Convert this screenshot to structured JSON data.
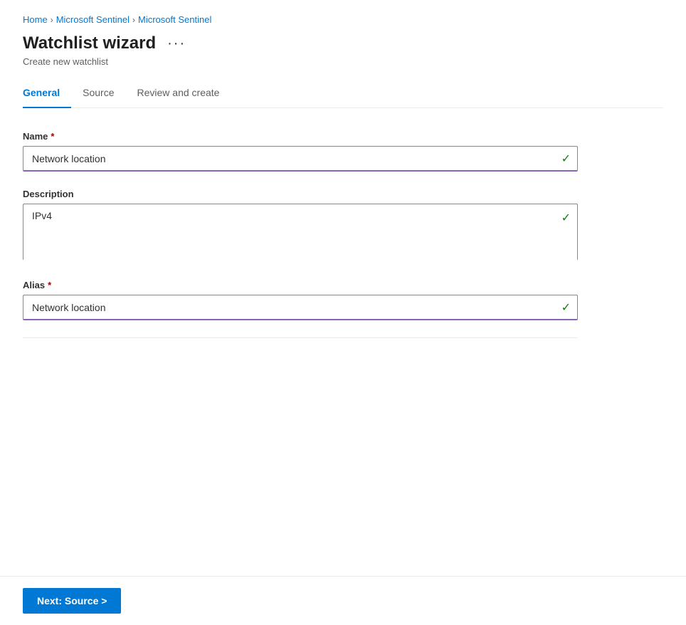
{
  "breadcrumb": {
    "items": [
      {
        "label": "Home",
        "href": "#"
      },
      {
        "label": "Microsoft Sentinel",
        "href": "#"
      },
      {
        "label": "Microsoft Sentinel",
        "href": "#"
      }
    ],
    "separators": [
      ">",
      ">"
    ]
  },
  "header": {
    "title": "Watchlist wizard",
    "more_options_label": "···",
    "subtitle": "Create new watchlist"
  },
  "tabs": [
    {
      "label": "General",
      "active": true
    },
    {
      "label": "Source",
      "active": false
    },
    {
      "label": "Review and create",
      "active": false
    }
  ],
  "form": {
    "name_label": "Name",
    "name_required": "*",
    "name_value": "Network location",
    "name_checkmark": "✓",
    "description_label": "Description",
    "description_value": "IPv4",
    "description_checkmark": "✓",
    "alias_label": "Alias",
    "alias_required": "*",
    "alias_value": "Network location",
    "alias_checkmark": "✓"
  },
  "footer": {
    "next_btn_label": "Next: Source >"
  }
}
